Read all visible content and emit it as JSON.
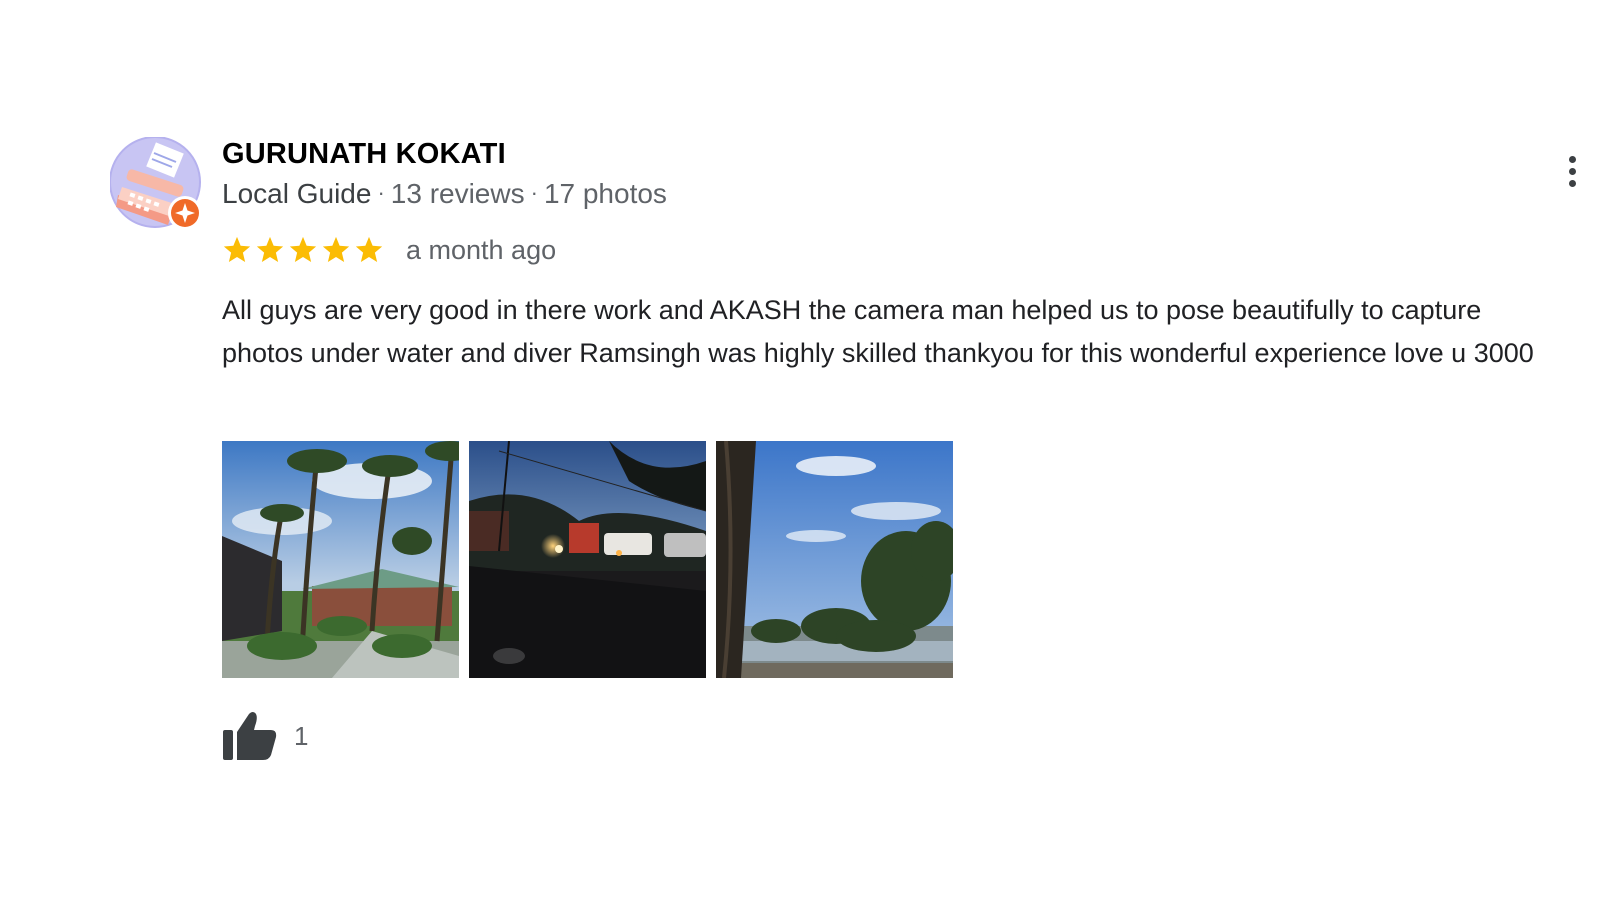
{
  "review": {
    "author_name": "GURUNATH KOKATI",
    "author_badge": "Local Guide",
    "reviews_count": "13 reviews",
    "photos_count": "17 photos",
    "rating": 5,
    "rating_max": 5,
    "time_ago": "a month ago",
    "text": "All guys are very good in there work and AKASH the camera man helped us to pose beautifully to capture photos under water and diver Ramsingh was highly skilled thankyou for this wonderful experience love u 3000",
    "likes_count": "1",
    "icons": {
      "avatar": "typewriter-avatar-icon",
      "badge": "local-guide-badge-icon",
      "star": "star-icon",
      "like": "thumbs-up-icon",
      "more": "more-vertical-icon"
    }
  },
  "colors": {
    "star": "#fbbc04",
    "badge": "#f06a28",
    "avatar_bg": "#c8c5f3"
  }
}
